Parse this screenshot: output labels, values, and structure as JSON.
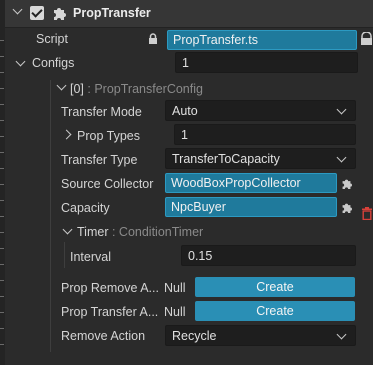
{
  "component": {
    "title": "PropTransfer",
    "enabled": true
  },
  "script": {
    "label": "Script",
    "value": "PropTransfer.ts"
  },
  "configs": {
    "label": "Configs",
    "count": "1",
    "element": {
      "label": "[0]",
      "type_suffix": ": PropTransferConfig",
      "transfer_mode": {
        "label": "Transfer Mode",
        "value": "Auto"
      },
      "prop_types": {
        "label": "Prop Types",
        "value": "1"
      },
      "transfer_type": {
        "label": "Transfer Type",
        "value": "TransferToCapacity"
      },
      "source_collector": {
        "label": "Source Collector",
        "value": "WoodBoxPropCollector"
      },
      "capacity": {
        "label": "Capacity",
        "value": "NpcBuyer"
      },
      "timer": {
        "label": "Timer",
        "type_suffix": ": ConditionTimer",
        "interval": {
          "label": "Interval",
          "value": "0.15"
        }
      },
      "prop_remove_action": {
        "label": "Prop Remove A...",
        "null_text": "Null",
        "button": "Create"
      },
      "prop_transfer_action": {
        "label": "Prop Transfer A...",
        "null_text": "Null",
        "button": "Create"
      },
      "remove_action": {
        "label": "Remove Action",
        "value": "Recycle"
      }
    }
  },
  "colors": {
    "reference_blue": "#1f7a9c",
    "button_blue": "#2a8fb5",
    "delete_red": "#d9413a"
  }
}
